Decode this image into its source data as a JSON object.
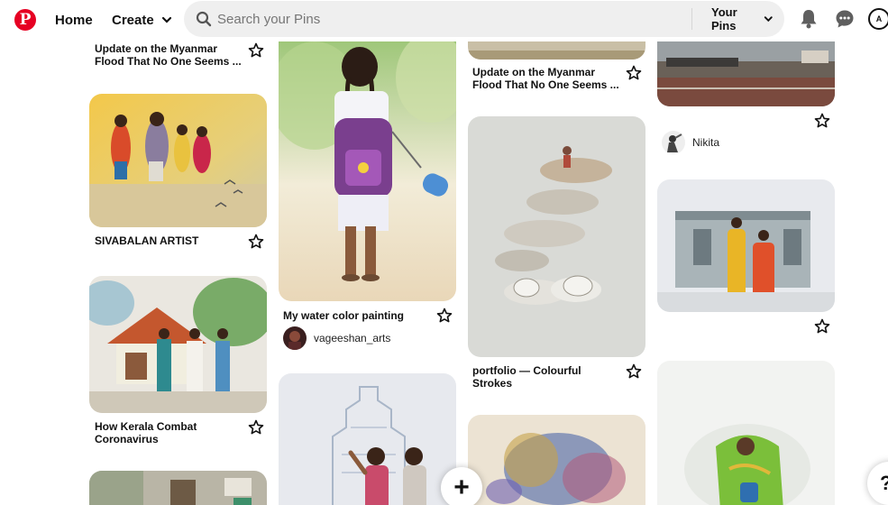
{
  "header": {
    "logo_letter": "P",
    "home_label": "Home",
    "create_label": "Create",
    "search_placeholder": "Search your Pins",
    "your_pins_label": "Your Pins",
    "user_initial": "A"
  },
  "pins": {
    "c1_top_title": "Update on the Myanmar Flood That No One Seems ...",
    "c1_sivabalan_title": "SIVABALAN ARTIST",
    "c1_kerala_title": "How Kerala Combat Coronavirus",
    "c2_water_title": "My water color painting",
    "c2_water_owner": "vageeshan_arts",
    "c3_myanmar_title": "Update on the Myanmar Flood That No One Seems ...",
    "c3_portfolio_title": "portfolio — Colourful Strokes",
    "c4_owner": "Nikita"
  },
  "fab": {
    "label": "+"
  },
  "help": {
    "label": "?"
  },
  "colors": {
    "brand": "#e60023",
    "search_bg": "#efefef"
  }
}
